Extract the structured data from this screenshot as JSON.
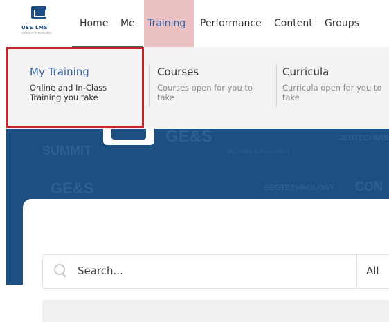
{
  "logo": {
    "text": "UES LMS",
    "subtext": "UNIVERSITY OF EXCELLENCE"
  },
  "nav": {
    "items": [
      "Home",
      "Me",
      "Training",
      "Performance",
      "Content",
      "Groups"
    ],
    "active": "Training"
  },
  "dropdown": {
    "items": [
      {
        "title": "My Training",
        "desc_line1": "Online and In-Class",
        "desc_line2": "Training you take"
      },
      {
        "title": "Courses",
        "desc_line1": "Courses open for you to",
        "desc_line2": "take"
      },
      {
        "title": "Curricula",
        "desc_line1": "Curricula open for you to",
        "desc_line2": "take"
      }
    ]
  },
  "banner": {
    "watermarks": [
      "SUMMIT",
      "GE&S",
      "McGinley & Associates",
      "GEOTECHNOLOGY",
      "GE&S",
      "GEOTECHNOLOGY",
      "CON"
    ]
  },
  "search": {
    "placeholder": "Search...",
    "filter": "All"
  },
  "colors": {
    "brand": "#1c4f82",
    "active_tab_bg": "#e7b5b8",
    "highlight_border": "#c9252c",
    "link_blue": "#3a67a8"
  }
}
